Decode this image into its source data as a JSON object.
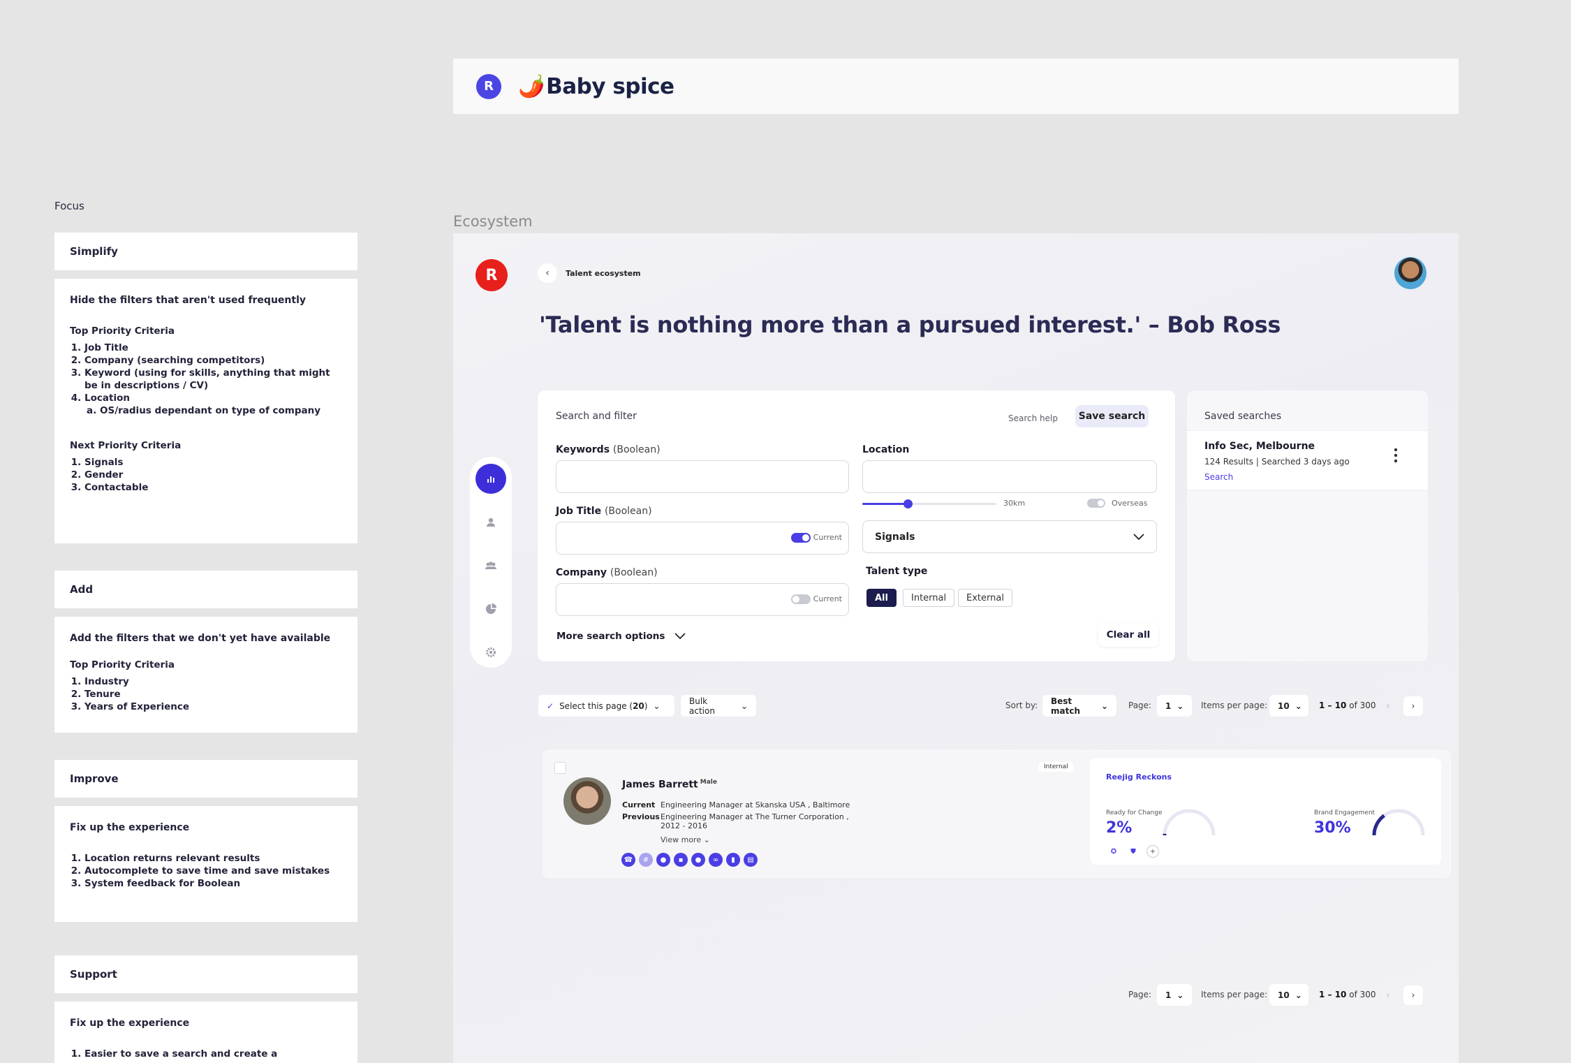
{
  "notes": {
    "focus_label": "Focus",
    "simplify": {
      "head": "Simplify",
      "title": "Hide the filters that aren't used frequently",
      "top_label": "Top Priority Criteria",
      "top_items": [
        "Job Title",
        "Company (searching competitors)",
        "Keyword (using for skills, anything that might be in descriptions / CV)",
        "Location"
      ],
      "location_sub": "OS/radius dependant on type of company",
      "next_label": "Next Priority Criteria",
      "next_items": [
        "Signals",
        "Gender",
        "Contactable"
      ]
    },
    "add": {
      "head": "Add",
      "title": "Add the filters that we don't yet have available",
      "top_label": "Top Priority Criteria",
      "items": [
        "Industry",
        "Tenure",
        "Years of Experience"
      ]
    },
    "improve": {
      "head": "Improve",
      "title": "Fix up the experience",
      "items": [
        "Location returns relevant results",
        "Autocomplete to save time and save mistakes",
        "System feedback for Boolean"
      ]
    },
    "support": {
      "head": "Support",
      "title": "Fix up the experience",
      "items": [
        "Easier to save a search and create a"
      ]
    }
  },
  "topbar": {
    "pepper": "🌶️",
    "brand": "Baby spice",
    "logo_letter": "R"
  },
  "ecosystem_label": "Ecosystem",
  "app": {
    "logo_letter": "R",
    "breadcrumb": "Talent ecosystem",
    "quote": "'Talent is nothing more than a pursued interest.' – Bob Ross",
    "search": {
      "title": "Search and filter",
      "help": "Search help",
      "save": "Save search",
      "keywords_label": "Keywords",
      "keywords_hint": "(Boolean)",
      "location_label": "Location",
      "jobtitle_label": "Job Title",
      "jobtitle_hint": "(Boolean)",
      "company_label": "Company",
      "company_hint": "(Boolean)",
      "current_label": "Current",
      "radius": "30km",
      "radius_fraction": 0.34,
      "overseas": "Overseas",
      "signals": "Signals",
      "talent_type_label": "Talent type",
      "talent_types": [
        "All",
        "Internal",
        "External"
      ],
      "more_options": "More search options",
      "clear_all": "Clear all"
    },
    "saved": {
      "title": "Saved searches",
      "item_name": "Info Sec, Melbourne",
      "item_meta": "124 Results | Searched 3 days ago",
      "item_link": "Search"
    },
    "toolbar": {
      "select_page": "Select this page (",
      "select_count": "20",
      "select_close": ")",
      "bulk": "Bulk action",
      "sort_label": "Sort by:",
      "sort_value": "Best match",
      "page_label": "Page:",
      "page_value": "1",
      "ipp_label": "Items per page:",
      "ipp_value": "10",
      "range": "1 – 10",
      "of": "of",
      "total": "300"
    },
    "result": {
      "name": "James Barrett",
      "gender": "Male",
      "badge": "Internal",
      "current_k": "Current",
      "current_v": "Engineering Manager at Skanska USA , Baltimore",
      "previous_k": "Previous",
      "previous_v": "Engineering Manager at The Turner Corporation , 2012 - 2016",
      "view_more": "View more",
      "reckons_title": "Reejig Reckons",
      "ready_label": "Ready for Change",
      "ready_value": "2%",
      "ready_fraction": 0.02,
      "brand_label": "Brand Engagement",
      "brand_value": "30%",
      "brand_fraction": 0.3
    },
    "bottom_bar": {
      "page_label": "Page:",
      "page_value": "1",
      "ipp_label": "Items per page:",
      "ipp_value": "10",
      "range": "1 – 10",
      "of": "of",
      "total": "300"
    },
    "colors": {
      "accent": "#4a3ee4",
      "brand_red": "#e8201c",
      "navy": "#1c1c4e"
    }
  }
}
